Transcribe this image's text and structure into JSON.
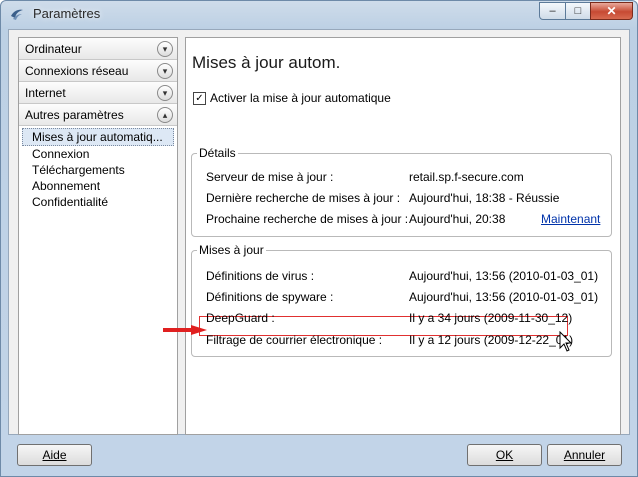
{
  "window": {
    "title": "Paramètres",
    "app_icon": "f-secure-logo-icon",
    "controls": {
      "minimize": "–",
      "maximize": "□",
      "close": "✕"
    }
  },
  "sidebar": {
    "categories": [
      {
        "label": "Ordinateur",
        "icon": "chevron-down-icon"
      },
      {
        "label": "Connexions réseau",
        "icon": "chevron-down-icon"
      },
      {
        "label": "Internet",
        "icon": "chevron-down-icon"
      },
      {
        "label": "Autres paramètres",
        "icon": "chevron-up-icon"
      }
    ],
    "subitems": [
      {
        "label": "Mises à jour automatiq...",
        "selected": true
      },
      {
        "label": "Connexion"
      },
      {
        "label": "Téléchargements"
      },
      {
        "label": "Abonnement"
      },
      {
        "label": "Confidentialité"
      }
    ]
  },
  "main": {
    "heading": "Mises à jour autom.",
    "auto_update": {
      "label": "Activer la mise à jour automatique",
      "checked": true,
      "mark": "✓"
    },
    "details": {
      "legend": "Détails",
      "rows": [
        {
          "label": "Serveur de mise à jour :",
          "value": "retail.sp.f-secure.com"
        },
        {
          "label": "Dernière recherche de mises à jour :",
          "value": "Aujourd'hui, 18:38 - Réussie"
        },
        {
          "label": "Prochaine recherche de mises à jour :",
          "value": "Aujourd'hui, 20:38",
          "link": "Maintenant"
        }
      ]
    },
    "updates": {
      "legend": "Mises à jour",
      "rows": [
        {
          "label": "Définitions de virus :",
          "value": "Aujourd'hui, 13:56 (2010-01-03_01)"
        },
        {
          "label": "Définitions de spyware :",
          "value": "Aujourd'hui, 13:56 (2010-01-03_01)"
        },
        {
          "label": "DeepGuard :",
          "value": "Il y a 34 jours (2009-11-30_12)",
          "highlighted": true
        },
        {
          "label": "Filtrage de courrier électronique :",
          "value": "Il y a 12 jours (2009-12-22_01)"
        }
      ]
    }
  },
  "footer": {
    "help": "Aide",
    "ok": "OK",
    "cancel": "Annuler"
  },
  "colors": {
    "highlight": "#e03030",
    "link": "#0033aa",
    "arrow": "#e02020"
  }
}
